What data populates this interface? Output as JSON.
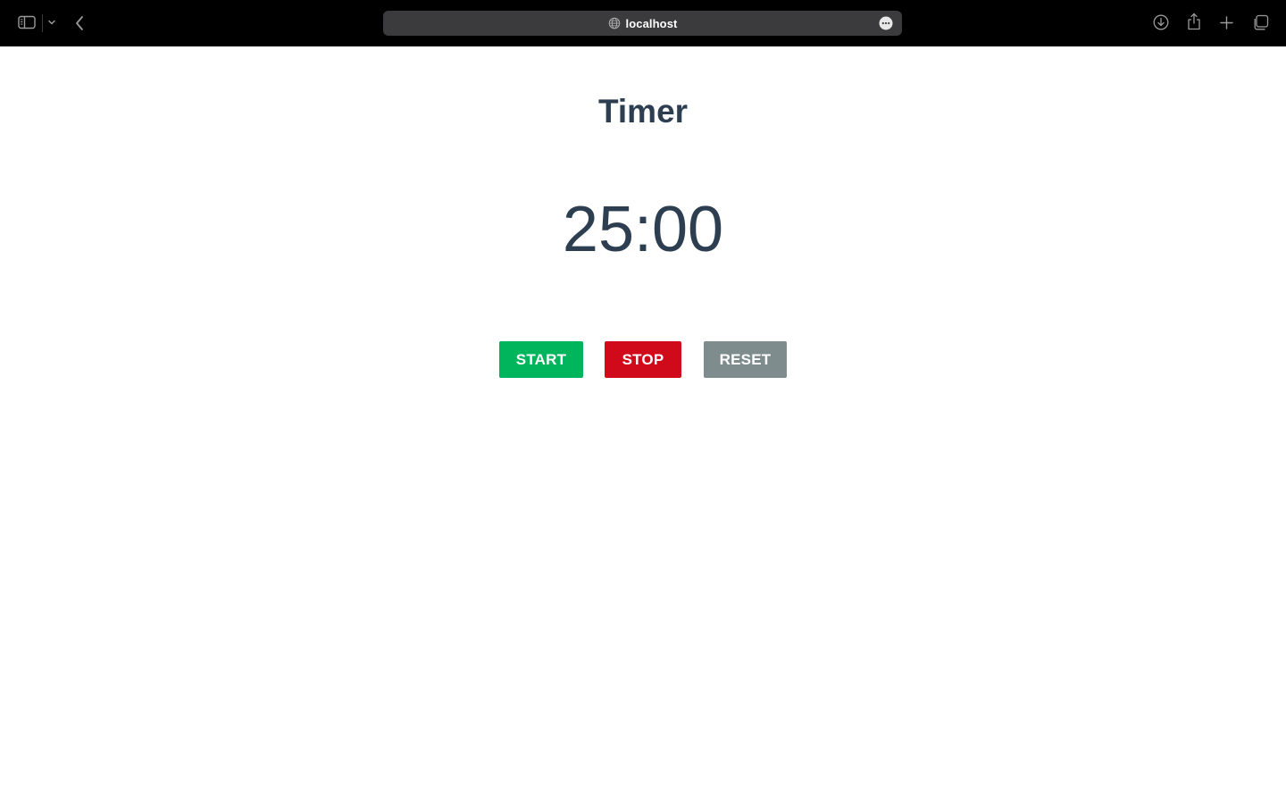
{
  "browser": {
    "address": "localhost",
    "icons": {
      "sidebar": "sidebar-icon",
      "sidebar_dropdown": "chevron-down-icon",
      "back": "chevron-left-icon",
      "site": "globe-icon",
      "more": "ellipsis-circle-icon",
      "download": "download-icon",
      "share": "share-icon",
      "new_tab": "plus-icon",
      "tabs": "tabs-overview-icon"
    }
  },
  "timer": {
    "title": "Timer",
    "time": "25:00"
  },
  "controls": {
    "start_label": "START",
    "stop_label": "STOP",
    "reset_label": "RESET"
  },
  "colors": {
    "start": "#00b55b",
    "stop": "#d0091b",
    "reset": "#7f8c8d",
    "text": "#2c3e50",
    "chrome_bg": "#000000",
    "address_bg": "#3b3b3d"
  }
}
